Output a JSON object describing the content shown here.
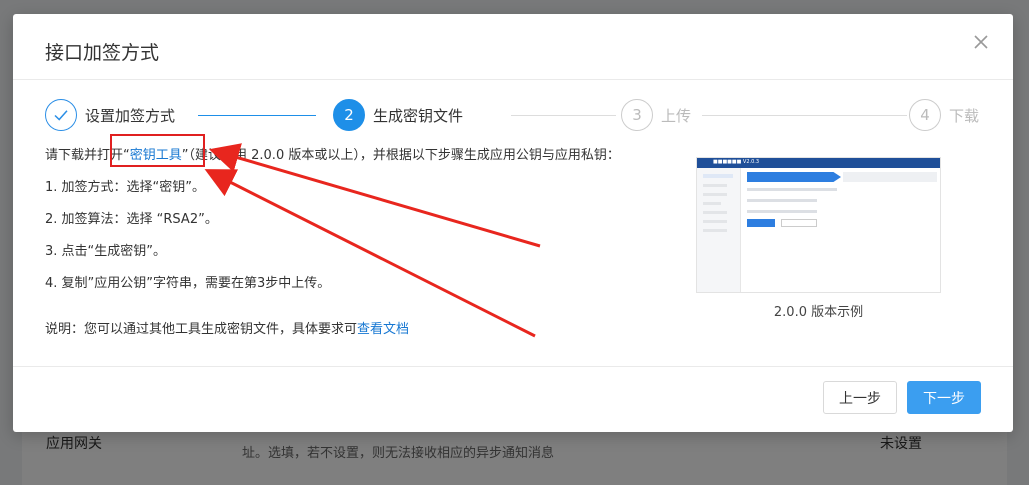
{
  "background": {
    "row_label": "应用网关",
    "row_desc": "址。选填，若不设置，则无法接收相应的异步通知消息",
    "row_status": "未设置"
  },
  "modal": {
    "title": "接口加签方式",
    "close_icon": "close-icon"
  },
  "steps": [
    {
      "number": "",
      "label": "设置加签方式",
      "state": "done"
    },
    {
      "number": "2",
      "label": "生成密钥文件",
      "state": "active"
    },
    {
      "number": "3",
      "label": "上传",
      "state": "pending"
    },
    {
      "number": "4",
      "label": "下载",
      "state": "pending"
    }
  ],
  "content": {
    "intro_prefix": "请下载并打开“",
    "tool_link": "密钥工具",
    "intro_suffix": "”（建议使用 2.0.0 版本或以上），并根据以下步骤生成应用公钥与应用私钥：",
    "items": [
      "1. 加签方式：选择“密钥”。",
      "2. 加签算法：选择 “RSA2”。",
      "3. 点击“生成密钥”。",
      "4. 复制”应用公钥”字符串，需要在第3步中上传。"
    ],
    "note_prefix": "说明：您可以通过其他工具生成密钥文件，具体要求可",
    "note_link": "查看文档"
  },
  "preview": {
    "caption": "2.0.0 版本示例"
  },
  "footer": {
    "prev_label": "上一步",
    "next_label": "下一步"
  },
  "colors": {
    "primary": "#1e8fe8",
    "link": "#1677d2",
    "annotation_red": "#e02020"
  }
}
